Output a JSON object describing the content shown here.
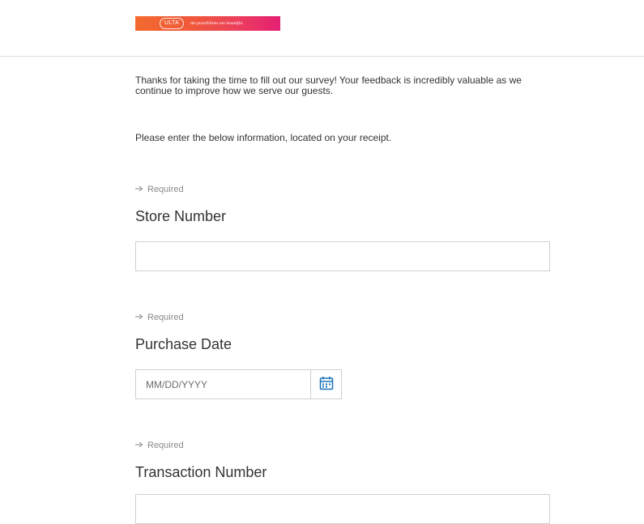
{
  "header": {
    "logo": {
      "brand": "ULTA",
      "tagline": "the possibilities are beautiful."
    }
  },
  "intro": {
    "text": "Thanks for taking the time to fill out our survey! Your feedback is incredibly valuable as we continue to improve how we serve our guests."
  },
  "instruction": {
    "text": "Please enter the below information, located on your receipt."
  },
  "questions": [
    {
      "required_label": "Required",
      "title": "Store Number",
      "value": "",
      "placeholder": ""
    },
    {
      "required_label": "Required",
      "title": "Purchase Date",
      "value": "",
      "placeholder": "MM/DD/YYYY",
      "icon": "calendar-icon"
    },
    {
      "required_label": "Required",
      "title": "Transaction Number",
      "value": "",
      "placeholder": ""
    }
  ],
  "colors": {
    "accent": "#1a73b8",
    "border": "#cfcfcf",
    "required_text": "#8a8a8a",
    "logo_gradient_start": "#f26a2e",
    "logo_gradient_end": "#e61f74"
  }
}
